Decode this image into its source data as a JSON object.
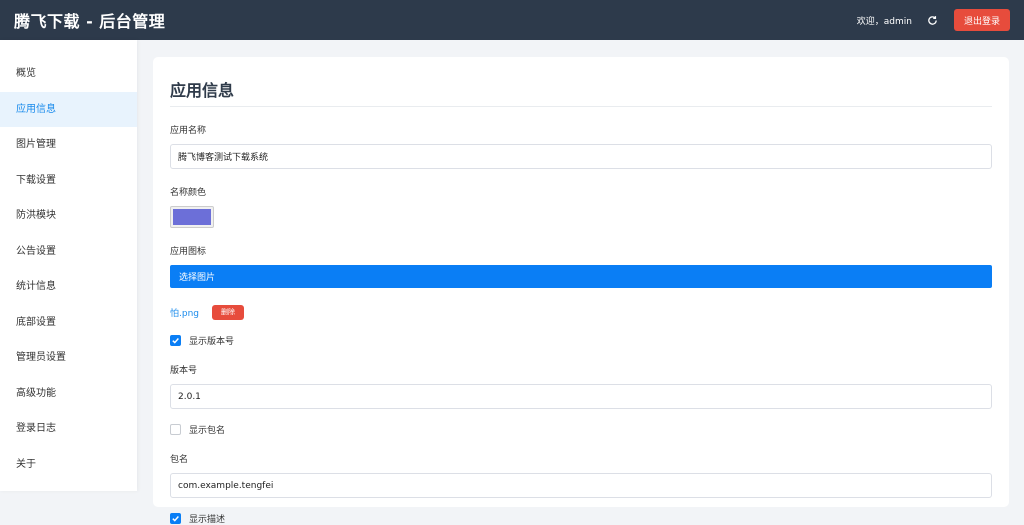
{
  "header": {
    "title": "腾飞下载 - 后台管理",
    "welcome": "欢迎，admin",
    "logout_label": "退出登录"
  },
  "sidebar": {
    "items": [
      {
        "label": "概览"
      },
      {
        "label": "应用信息",
        "active": true
      },
      {
        "label": "图片管理"
      },
      {
        "label": "下载设置"
      },
      {
        "label": "防洪模块"
      },
      {
        "label": "公告设置"
      },
      {
        "label": "统计信息"
      },
      {
        "label": "底部设置"
      },
      {
        "label": "管理员设置"
      },
      {
        "label": "高级功能"
      },
      {
        "label": "登录日志"
      },
      {
        "label": "关于"
      }
    ]
  },
  "main": {
    "section_title": "应用信息",
    "app_name_label": "应用名称",
    "app_name_value": "腾飞博客测试下载系统",
    "name_color_label": "名称颜色",
    "name_color_value": "#6c6fd8",
    "app_icon_label": "应用图标",
    "choose_image_label": "选择图片",
    "file_name": "怕.png",
    "delete_label": "删除",
    "show_version_label": "显示版本号",
    "show_version_checked": true,
    "version_label": "版本号",
    "version_value": "2.0.1",
    "show_package_label": "显示包名",
    "show_package_checked": false,
    "package_label": "包名",
    "package_value": "com.example.tengfei",
    "show_desc_label": "显示描述",
    "show_desc_checked": true
  },
  "colors": {
    "header_bg": "#2d3a4b",
    "accent": "#0a7ef5",
    "danger": "#e74c3c",
    "active_nav_bg": "#e8f3fd"
  }
}
